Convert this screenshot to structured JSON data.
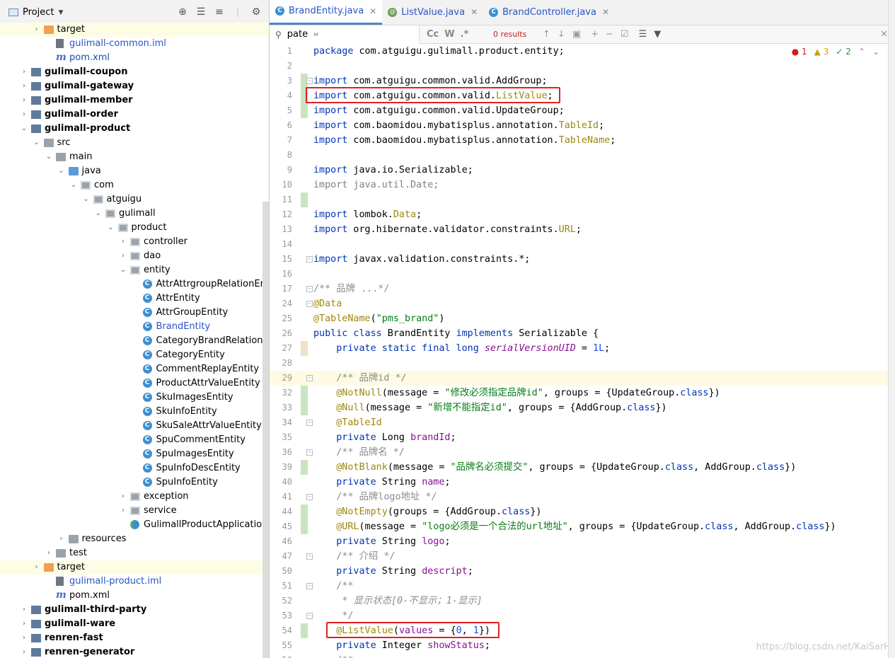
{
  "project_panel": {
    "title": "Project",
    "tree": [
      {
        "label": "target",
        "kind": "folder-orange",
        "indent": 1,
        "arrow": "›",
        "hl": true
      },
      {
        "label": "gulimall-common.iml",
        "kind": "iml",
        "indent": 2,
        "arrow": "",
        "style": "blue"
      },
      {
        "label": "pom.xml",
        "kind": "maven",
        "indent": 2,
        "arrow": "",
        "style": "dkblue"
      },
      {
        "label": "gulimall-coupon",
        "kind": "module",
        "indent": 0,
        "arrow": "›",
        "style": "bold"
      },
      {
        "label": "gulimall-gateway",
        "kind": "module",
        "indent": 0,
        "arrow": "›",
        "style": "bold"
      },
      {
        "label": "gulimall-member",
        "kind": "module",
        "indent": 0,
        "arrow": "›",
        "style": "bold"
      },
      {
        "label": "gulimall-order",
        "kind": "module",
        "indent": 0,
        "arrow": "›",
        "style": "bold"
      },
      {
        "label": "gulimall-product",
        "kind": "module",
        "indent": 0,
        "arrow": "⌄",
        "style": "bold"
      },
      {
        "label": "src",
        "kind": "folder",
        "indent": 1,
        "arrow": "⌄"
      },
      {
        "label": "main",
        "kind": "folder",
        "indent": 2,
        "arrow": "⌄"
      },
      {
        "label": "java",
        "kind": "folder-blue",
        "indent": 3,
        "arrow": "⌄"
      },
      {
        "label": "com",
        "kind": "pkg",
        "indent": 4,
        "arrow": "⌄"
      },
      {
        "label": "atguigu",
        "kind": "pkg",
        "indent": 5,
        "arrow": "⌄"
      },
      {
        "label": "gulimall",
        "kind": "pkg",
        "indent": 6,
        "arrow": "⌄"
      },
      {
        "label": "product",
        "kind": "pkg",
        "indent": 7,
        "arrow": "⌄"
      },
      {
        "label": "controller",
        "kind": "pkg",
        "indent": 8,
        "arrow": "›"
      },
      {
        "label": "dao",
        "kind": "pkg",
        "indent": 8,
        "arrow": "›"
      },
      {
        "label": "entity",
        "kind": "pkg",
        "indent": 8,
        "arrow": "⌄"
      },
      {
        "label": "AttrAttrgroupRelationEntity",
        "kind": "class",
        "indent": 9,
        "arrow": ""
      },
      {
        "label": "AttrEntity",
        "kind": "class",
        "indent": 9,
        "arrow": ""
      },
      {
        "label": "AttrGroupEntity",
        "kind": "class",
        "indent": 9,
        "arrow": ""
      },
      {
        "label": "BrandEntity",
        "kind": "class",
        "indent": 9,
        "arrow": "",
        "style": "blue"
      },
      {
        "label": "CategoryBrandRelationEntity",
        "kind": "class",
        "indent": 9,
        "arrow": ""
      },
      {
        "label": "CategoryEntity",
        "kind": "class",
        "indent": 9,
        "arrow": ""
      },
      {
        "label": "CommentReplayEntity",
        "kind": "class",
        "indent": 9,
        "arrow": ""
      },
      {
        "label": "ProductAttrValueEntity",
        "kind": "class",
        "indent": 9,
        "arrow": ""
      },
      {
        "label": "SkuImagesEntity",
        "kind": "class",
        "indent": 9,
        "arrow": ""
      },
      {
        "label": "SkuInfoEntity",
        "kind": "class",
        "indent": 9,
        "arrow": ""
      },
      {
        "label": "SkuSaleAttrValueEntity",
        "kind": "class",
        "indent": 9,
        "arrow": ""
      },
      {
        "label": "SpuCommentEntity",
        "kind": "class",
        "indent": 9,
        "arrow": ""
      },
      {
        "label": "SpuImagesEntity",
        "kind": "class",
        "indent": 9,
        "arrow": ""
      },
      {
        "label": "SpuInfoDescEntity",
        "kind": "class",
        "indent": 9,
        "arrow": ""
      },
      {
        "label": "SpuInfoEntity",
        "kind": "class",
        "indent": 9,
        "arrow": ""
      },
      {
        "label": "exception",
        "kind": "pkg",
        "indent": 8,
        "arrow": "›"
      },
      {
        "label": "service",
        "kind": "pkg",
        "indent": 8,
        "arrow": "›"
      },
      {
        "label": "GulimallProductApplication",
        "kind": "spring",
        "indent": 8,
        "arrow": ""
      },
      {
        "label": "resources",
        "kind": "folder",
        "indent": 3,
        "arrow": "›"
      },
      {
        "label": "test",
        "kind": "folder",
        "indent": 2,
        "arrow": "›"
      },
      {
        "label": "target",
        "kind": "folder-orange",
        "indent": 1,
        "arrow": "›",
        "hl": true
      },
      {
        "label": "gulimall-product.iml",
        "kind": "iml",
        "indent": 2,
        "arrow": "",
        "style": "blue"
      },
      {
        "label": "pom.xml",
        "kind": "maven",
        "indent": 2,
        "arrow": ""
      },
      {
        "label": "gulimall-third-party",
        "kind": "module",
        "indent": 0,
        "arrow": "›",
        "style": "bold"
      },
      {
        "label": "gulimall-ware",
        "kind": "module",
        "indent": 0,
        "arrow": "›",
        "style": "bold"
      },
      {
        "label": "renren-fast",
        "kind": "module",
        "indent": 0,
        "arrow": "›",
        "style": "bold"
      },
      {
        "label": "renren-generator",
        "kind": "module",
        "indent": 0,
        "arrow": "›",
        "style": "bold"
      }
    ]
  },
  "tabs": [
    {
      "label": "BrandEntity.java",
      "icon": "C",
      "active": true
    },
    {
      "label": "ListValue.java",
      "icon": "@",
      "active": false
    },
    {
      "label": "BrandController.java",
      "icon": "C",
      "active": false
    }
  ],
  "find": {
    "query": "pate",
    "results": "0 results",
    "opt_case": "Cc",
    "opt_word": "W",
    "opt_regex": ".*"
  },
  "inspections": {
    "errors": "1",
    "warnings": "3",
    "ok": "2"
  },
  "watermark": "https://blog.csdn.net/KaiSarH",
  "code_lines": [
    {
      "n": "1",
      "html": "<span class='k'>package</span> com.atguigu.gulimall.product.entity;"
    },
    {
      "n": "2",
      "html": ""
    },
    {
      "n": "3",
      "html": "<span class='k'>import</span> com.atguigu.common.valid.AddGroup;",
      "g": "chg",
      "fold": true
    },
    {
      "n": "4",
      "html": "<span class='k'>import</span> com.atguigu.common.valid.<span class='an'>ListValue</span>;",
      "g": "chg"
    },
    {
      "n": "5",
      "html": "<span class='k'>import</span> com.atguigu.common.valid.UpdateGroup;",
      "g": "chg"
    },
    {
      "n": "6",
      "html": "<span class='k'>import</span> com.baomidou.mybatisplus.annotation.<span class='an'>TableId</span>;"
    },
    {
      "n": "7",
      "html": "<span class='k'>import</span> com.baomidou.mybatisplus.annotation.<span class='an'>TableName</span>;"
    },
    {
      "n": "8",
      "html": ""
    },
    {
      "n": "9",
      "html": "<span class='k'>import</span> java.io.Serializable;"
    },
    {
      "n": "10",
      "html": "<span class='dim'>import java.util.Date;</span>"
    },
    {
      "n": "11",
      "html": "",
      "g": "chg"
    },
    {
      "n": "12",
      "html": "<span class='k'>import</span> lombok.<span class='an'>Data</span>;"
    },
    {
      "n": "13",
      "html": "<span class='k'>import</span> org.hibernate.validator.constraints.<span class='an'>URL</span>;"
    },
    {
      "n": "14",
      "html": ""
    },
    {
      "n": "15",
      "html": "<span class='k'>import</span> javax.validation.constraints.*;",
      "fold": true
    },
    {
      "n": "16",
      "html": ""
    },
    {
      "n": "17",
      "html": "<span class='cmd'>/** 品牌 ...*/</span>",
      "fold": true
    },
    {
      "n": "24",
      "html": "<span class='an'>@Data</span>",
      "fold": true
    },
    {
      "n": "25",
      "html": "<span class='an'>@TableName</span>(<span class='str'>\"pms_brand\"</span>)"
    },
    {
      "n": "26",
      "html": "<span class='k'>public class</span> BrandEntity <span class='k'>implements</span> Serializable {"
    },
    {
      "n": "27",
      "html": "    <span class='k'>private static final long</span> <span class='fld' style='font-style:italic'>serialVersionUID</span> = <span class='num'>1L</span>;",
      "g": "mod"
    },
    {
      "n": "28",
      "html": ""
    },
    {
      "n": "29",
      "html": "    <span class='cmd'>/** 品牌id */</span>",
      "fold": true,
      "cur": true
    },
    {
      "n": "32",
      "html": "    <span class='an'>@NotNull</span>(message = <span class='str'>\"修改必须指定品牌id\"</span>, groups = {UpdateGroup.<span class='k'>class</span>})",
      "g": "chg"
    },
    {
      "n": "33",
      "html": "    <span class='an'>@Null</span>(message = <span class='str'>\"新增不能指定id\"</span>, groups = {AddGroup.<span class='k'>class</span>})",
      "g": "chg"
    },
    {
      "n": "34",
      "html": "    <span class='an'>@TableId</span>",
      "fold": true
    },
    {
      "n": "35",
      "html": "    <span class='k'>private</span> Long <span class='fld'>brandId</span>;"
    },
    {
      "n": "36",
      "html": "    <span class='cmd'>/** 品牌名 */</span>",
      "fold": true
    },
    {
      "n": "39",
      "html": "    <span class='an'>@NotBlank</span>(message = <span class='str'>\"品牌名必须提交\"</span>, groups = {UpdateGroup.<span class='k'>class</span>, AddGroup.<span class='k'>class</span>})",
      "g": "chg"
    },
    {
      "n": "40",
      "html": "    <span class='k'>private</span> String <span class='fld'>name</span>;"
    },
    {
      "n": "41",
      "html": "    <span class='cmd'>/** 品牌logo地址 */</span>",
      "fold": true
    },
    {
      "n": "44",
      "html": "    <span class='an'>@NotEmpty</span>(groups = {AddGroup.<span class='k'>class</span>})",
      "g": "chg"
    },
    {
      "n": "45",
      "html": "    <span class='an'>@URL</span>(message = <span class='str'>\"logo必须是一个合法的url地址\"</span>, groups = {UpdateGroup.<span class='k'>class</span>, AddGroup.<span class='k'>class</span>})",
      "g": "chg"
    },
    {
      "n": "46",
      "html": "    <span class='k'>private</span> String <span class='fld'>logo</span>;"
    },
    {
      "n": "47",
      "html": "    <span class='cmd'>/** 介绍 */</span>",
      "fold": true
    },
    {
      "n": "50",
      "html": "    <span class='k'>private</span> String <span class='fld'>descript</span>;"
    },
    {
      "n": "51",
      "html": "    <span class='cmd'>/**</span>",
      "fold": true
    },
    {
      "n": "52",
      "html": "     <span class='cm'>* 显示状态[0-不显示；1-显示]</span>"
    },
    {
      "n": "53",
      "html": "     <span class='cmd'>*/</span>",
      "fold": true
    },
    {
      "n": "54",
      "html": "    <span class='an'>@ListValue</span>(<span class='fld'>values</span> = {<span class='num'>0</span>, <span class='num'>1</span>})",
      "g": "chg"
    },
    {
      "n": "55",
      "html": "    <span class='k'>private</span> Integer <span class='fld'>showStatus</span>;"
    },
    {
      "n": "56",
      "html": "    <span class='cmd'>/**</span>"
    }
  ]
}
